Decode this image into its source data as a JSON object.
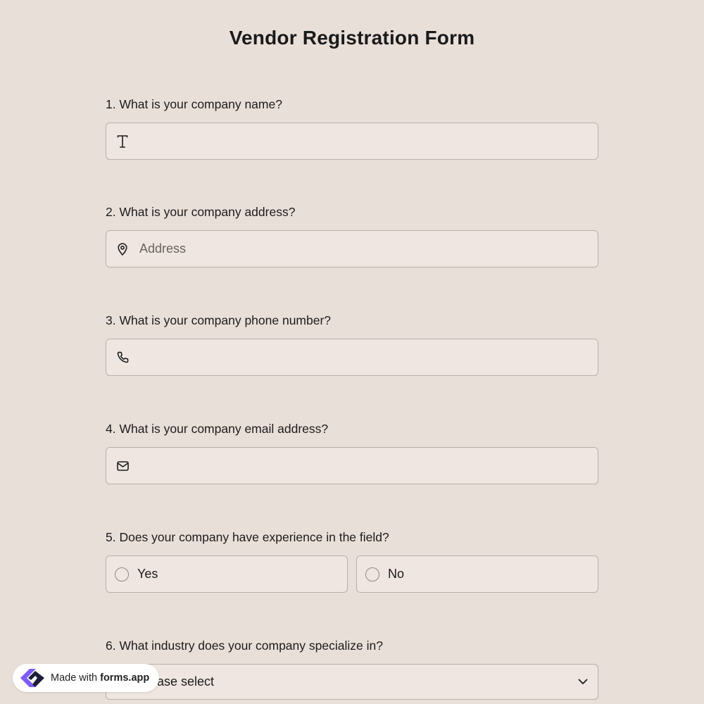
{
  "form": {
    "title": "Vendor Registration Form"
  },
  "questions": [
    {
      "label": "1.  What is your company name?",
      "icon": "text-icon",
      "value": "",
      "placeholder": ""
    },
    {
      "label": "2. What is your company address?",
      "icon": "location-pin-icon",
      "value": "",
      "placeholder": "Address"
    },
    {
      "label": "3. What is your company phone number?",
      "icon": "phone-icon",
      "value": "",
      "placeholder": ""
    },
    {
      "label": "4. What is your company email address?",
      "icon": "mail-icon",
      "value": "",
      "placeholder": ""
    },
    {
      "label": "5. Does your company have experience in the field?",
      "options": [
        "Yes",
        "No"
      ]
    },
    {
      "label": "6. What industry does your company specialize in?",
      "select_value": "Please select",
      "icon": "chevron-down-icon"
    }
  ],
  "badge": {
    "prefix": "Made with",
    "brand": "forms.app",
    "icon": "forms-app-logo-icon"
  },
  "colors": {
    "background": "#e9dfd9",
    "field_background": "#efe6e1",
    "field_border": "#b9b0ab",
    "logo_purple": "#7c5cff",
    "logo_dark": "#1d1e3a"
  }
}
